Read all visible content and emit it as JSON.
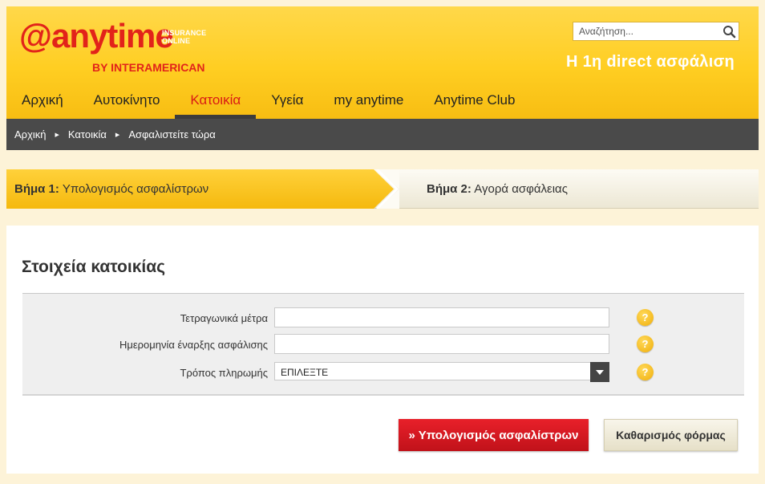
{
  "brand": {
    "logo_text": "anytime",
    "logo_tag_line1": "INSURANCE",
    "logo_tag_line2": "ONLINE",
    "logo_by": "BY INTERAMERICAN",
    "tagline": "Η 1η direct ασφάλιση",
    "brand_color": "#e2231a",
    "header_color": "#ffce22"
  },
  "search": {
    "placeholder": "Αναζήτηση...",
    "icon": "search-icon"
  },
  "nav": {
    "tabs": [
      {
        "label": "Αρχική",
        "active": false
      },
      {
        "label": "Αυτοκίνητο",
        "active": false
      },
      {
        "label": "Κατοικία",
        "active": true
      },
      {
        "label": "Υγεία",
        "active": false
      },
      {
        "label": "my anytime",
        "active": false
      },
      {
        "label": "Anytime Club",
        "active": false
      }
    ]
  },
  "breadcrumb": {
    "items": [
      "Αρχική",
      "Κατοικία",
      "Ασφαλιστείτε τώρα"
    ]
  },
  "steps": {
    "step1_prefix": "Βήμα 1:",
    "step1_label": "Υπολογισμός ασφαλίστρων",
    "step2_prefix": "Βήμα 2:",
    "step2_label": "Αγορά ασφάλειας",
    "active_step": 1
  },
  "form": {
    "title": "Στοιχεία κατοικίας",
    "fields": [
      {
        "label": "Τετραγωνικά μέτρα",
        "value": ""
      },
      {
        "label": "Ημερομηνία έναρξης ασφάλισης",
        "value": ""
      },
      {
        "label": "Τρόπος πληρωμής",
        "value": "ΕΠΙΛΕΞΤΕ"
      }
    ],
    "help_glyph": "?"
  },
  "buttons": {
    "calculate": "» Υπολογισμός ασφαλίστρων",
    "clear": "Καθαρισμός φόρμας"
  }
}
